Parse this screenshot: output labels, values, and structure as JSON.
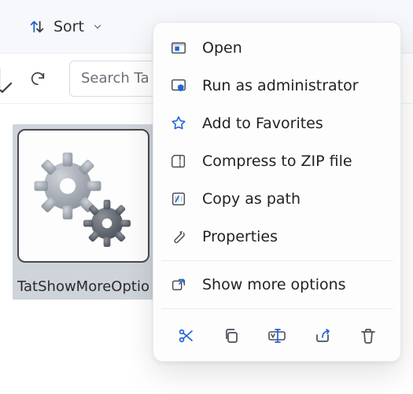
{
  "colors": {
    "accent": "#1f66d1",
    "icon": "#4a4f57",
    "text": "#1b1b1b"
  },
  "toolbar": {
    "sort_label": "Sort"
  },
  "search": {
    "placeholder": "Search Ta"
  },
  "file": {
    "name": "TatShowMoreOptio"
  },
  "menu": {
    "items": [
      {
        "label": "Open"
      },
      {
        "label": "Run as administrator"
      },
      {
        "label": "Add to Favorites"
      },
      {
        "label": "Compress to ZIP file"
      },
      {
        "label": "Copy as path"
      },
      {
        "label": "Properties"
      }
    ],
    "more_label": "Show more options",
    "actions": [
      "cut",
      "copy",
      "rename",
      "share",
      "delete"
    ]
  }
}
